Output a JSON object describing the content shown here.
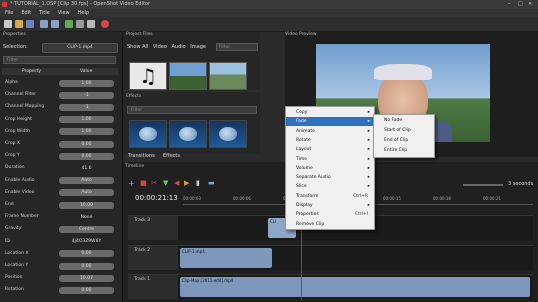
{
  "window": {
    "title": "* TUTORIAL_1.OSP [Clip 30 fps] - OpenShot Video Editor"
  },
  "menu": [
    "File",
    "Edit",
    "Title",
    "View",
    "Help"
  ],
  "properties": {
    "title": "Properties",
    "selection_label": "Selection:",
    "selection_value": "CLIP-1.mp4",
    "filter_placeholder": "Filter",
    "col_property": "Property",
    "col_value": "Value",
    "rows": [
      {
        "name": "Alpha",
        "value": "1.00"
      },
      {
        "name": "Channel Filter",
        "value": "-1"
      },
      {
        "name": "Channel Mapping",
        "value": "-1"
      },
      {
        "name": "Crop Height",
        "value": "1.00"
      },
      {
        "name": "Crop Width",
        "value": "1.00"
      },
      {
        "name": "Crop X",
        "value": "0.00"
      },
      {
        "name": "Crop Y",
        "value": "0.00"
      },
      {
        "name": "Duration",
        "value": "41.6"
      },
      {
        "name": "Enable Audio",
        "value": "Auto"
      },
      {
        "name": "Enable Video",
        "value": "Auto"
      },
      {
        "name": "End",
        "value": "10.00"
      },
      {
        "name": "Frame Number",
        "value": "None"
      },
      {
        "name": "Gravity",
        "value": "Centre"
      },
      {
        "name": "ID",
        "value": "4J4O3Z9W6Y"
      },
      {
        "name": "Location X",
        "value": "0.00"
      },
      {
        "name": "Location Y",
        "value": "0.00"
      },
      {
        "name": "Position",
        "value": "10.07"
      },
      {
        "name": "Rotation",
        "value": "0.00"
      }
    ]
  },
  "project_files": {
    "title": "Project Files",
    "tabs": [
      "Show All",
      "Video",
      "Audio",
      "Image"
    ],
    "filter_placeholder": "Filter"
  },
  "effects": {
    "title": "Effects",
    "filter_placeholder": "Filter"
  },
  "bottom_tabs": [
    "Transitions",
    "Effects"
  ],
  "preview": {
    "title": "Video Preview"
  },
  "timeline": {
    "title": "Timeline",
    "timecode": "00:00:21:13",
    "zoom_label": "3 seconds",
    "ruler": [
      "00:00:03",
      "00:00:06",
      "00:00:09",
      "00:00:12",
      "00:00:15",
      "00:00:18",
      "00:00:21"
    ],
    "tracks": [
      {
        "name": "Track 3",
        "clip": "CLI"
      },
      {
        "name": "Track 2",
        "clip": "CLIP-1.mp4"
      },
      {
        "name": "Track 1",
        "clip": "Clip-May [2011-edit].mp4"
      }
    ]
  },
  "context_menu": {
    "items": [
      {
        "label": "Copy",
        "shortcut": "",
        "submenu": true
      },
      {
        "label": "Fade",
        "shortcut": "",
        "submenu": true
      },
      {
        "label": "Animate",
        "shortcut": "",
        "submenu": true
      },
      {
        "label": "Rotate",
        "shortcut": "",
        "submenu": true
      },
      {
        "label": "Layout",
        "shortcut": "",
        "submenu": true
      },
      {
        "label": "Time",
        "shortcut": "",
        "submenu": true
      },
      {
        "label": "Volume",
        "shortcut": "",
        "submenu": true
      },
      {
        "label": "Separate Audio",
        "shortcut": "",
        "submenu": true
      },
      {
        "label": "Slice",
        "shortcut": "",
        "submenu": true
      },
      {
        "label": "Transform",
        "shortcut": "Ctrl+R",
        "submenu": false
      },
      {
        "label": "Display",
        "shortcut": "",
        "submenu": true
      },
      {
        "label": "Properties",
        "shortcut": "Ctrl+I",
        "submenu": false
      },
      {
        "label": "Remove Clip",
        "shortcut": "",
        "submenu": false
      }
    ],
    "fade_submenu": [
      "No Fade",
      "Start of Clip",
      "End of Clip",
      "Entire Clip"
    ]
  },
  "colors": {
    "accent": "#2f6fc0",
    "playhead": "#e02020"
  }
}
